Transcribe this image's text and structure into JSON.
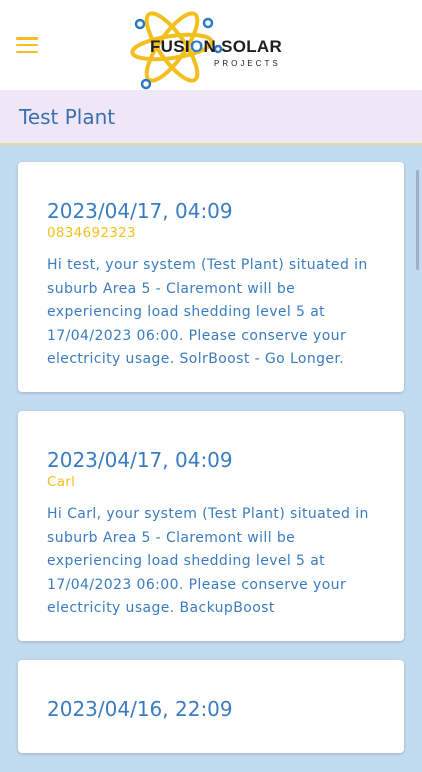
{
  "header": {
    "menu_icon": "hamburger-menu-icon",
    "logo_title": "FUSI",
    "logo_title_o": "O",
    "logo_title_rest": "N SOLAR",
    "logo_subtitle": "PROJECTS",
    "accent_color": "#f2bf1c",
    "brand_blue": "#2b79c2"
  },
  "page": {
    "title": "Test Plant"
  },
  "messages": [
    {
      "time": "2023/04/17, 04:09",
      "sender": "0834692323",
      "text": "Hi test, your system (Test Plant) situated in suburb Area 5 - Claremont will be experiencing load shedding level 5 at 17/04/2023 06:00. Please conserve your electricity usage. SolrBoost - Go Longer."
    },
    {
      "time": "2023/04/17, 04:09",
      "sender": "Carl",
      "text": "Hi Carl, your system (Test Plant) situated in suburb Area 5 - Claremont will be experiencing load shedding level 5 at 17/04/2023 06:00. Please conserve your electricity usage. BackupBoost"
    },
    {
      "time": "2023/04/16, 22:09",
      "sender": "",
      "text": ""
    }
  ]
}
